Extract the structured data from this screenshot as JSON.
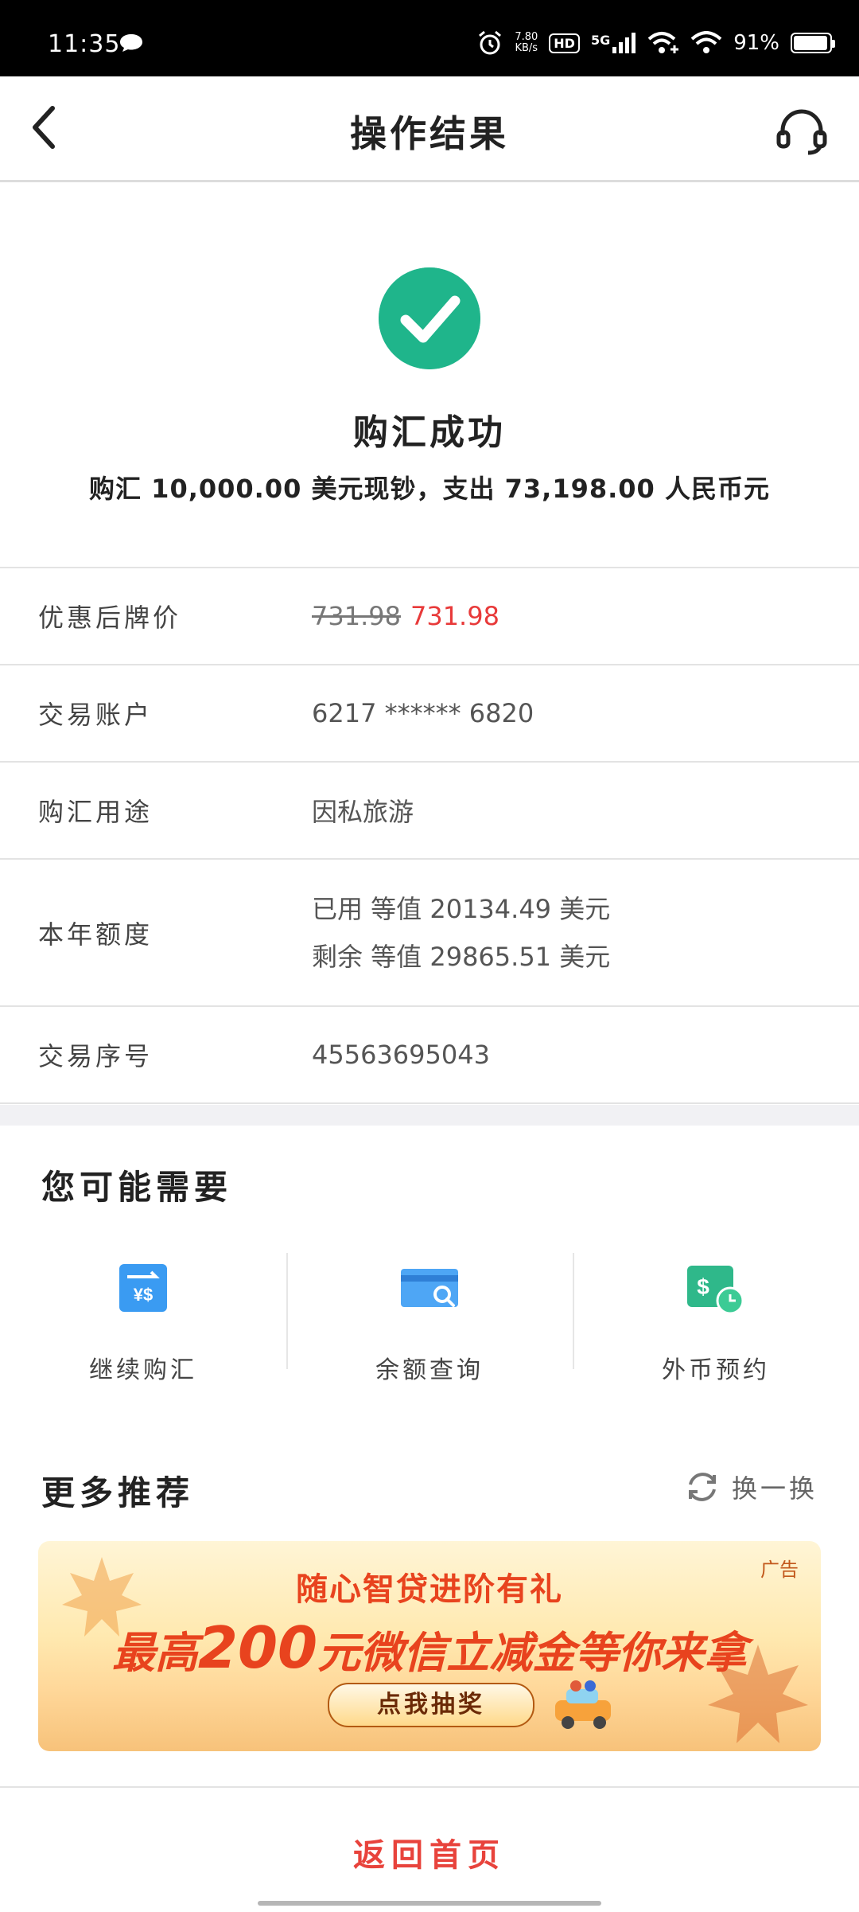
{
  "status_bar": {
    "time": "11:35",
    "net_speed_value": "7.80",
    "net_speed_unit": "KB/s",
    "hd": "HD",
    "network": "5G",
    "battery": "91%"
  },
  "header": {
    "title": "操作结果"
  },
  "result": {
    "headline": "购汇成功",
    "description": "购汇 10,000.00 美元现钞，支出 73,198.00 人民币元"
  },
  "details": {
    "price_label": "优惠后牌价",
    "price_original": "731.98",
    "price_discounted": "731.98",
    "account_label": "交易账户",
    "account_value": "6217 ****** 6820",
    "purpose_label": "购汇用途",
    "purpose_value": "因私旅游",
    "quota_label": "本年额度",
    "quota_used": "已用 等值 20134.49 美元",
    "quota_remaining": "剩余 等值 29865.51 美元",
    "serial_label": "交易序号",
    "serial_value": "45563695043"
  },
  "you_may_need": {
    "title": "您可能需要",
    "items": [
      {
        "label": "继续购汇",
        "icon": "exchange-icon"
      },
      {
        "label": "余额查询",
        "icon": "balance-query-icon"
      },
      {
        "label": "外币预约",
        "icon": "currency-reservation-icon"
      }
    ]
  },
  "more": {
    "title": "更多推荐",
    "refresh_label": "换一换"
  },
  "banner": {
    "tag": "广告",
    "line1": "随心智贷进阶有礼",
    "line2_prefix": "最高",
    "line2_amount": "200",
    "line2_suffix": "元微信立减金等你来拿",
    "button": "点我抽奖"
  },
  "footer": {
    "home_label": "返回首页"
  },
  "colors": {
    "success_green": "#1fb58b",
    "accent_red": "#e83a3a",
    "banner_red": "#e8431e"
  }
}
